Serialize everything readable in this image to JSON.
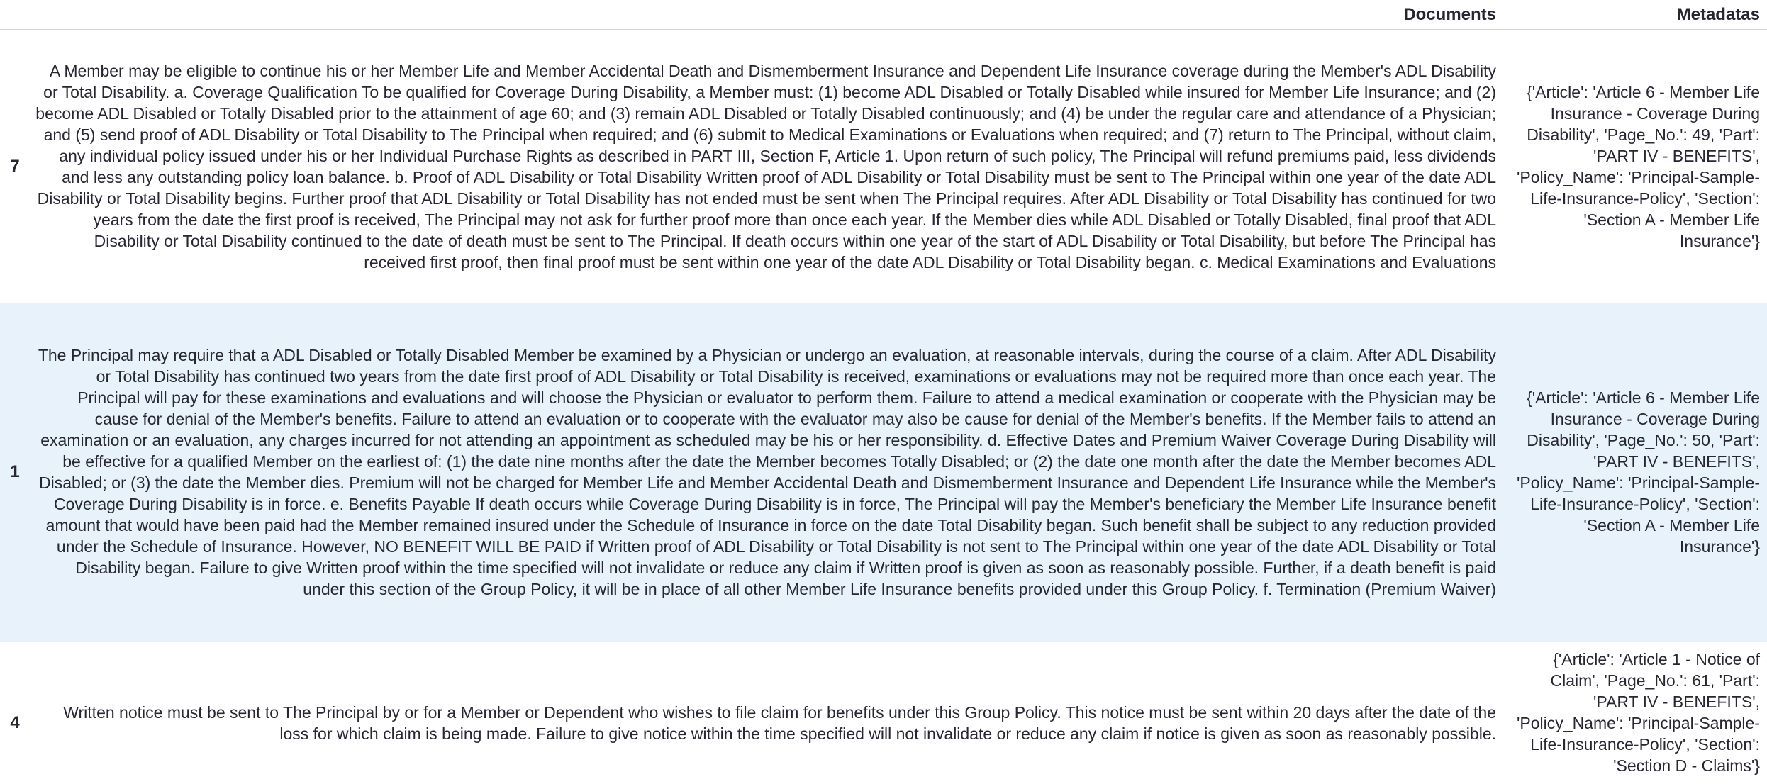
{
  "table": {
    "headers": {
      "index": "",
      "documents": "Documents",
      "metadatas": "Metadatas"
    },
    "rows": [
      {
        "index": "7",
        "document": "A Member may be eligible to continue his or her Member Life and Member Accidental Death and Dismemberment Insurance and Dependent Life Insurance coverage during the Member's ADL Disability or Total Disability. a. Coverage Qualification To be qualified for Coverage During Disability, a Member must: (1) become ADL Disabled or Totally Disabled while insured for Member Life Insurance; and (2) become ADL Disabled or Totally Disabled prior to the attainment of age 60; and (3) remain ADL Disabled or Totally Disabled continuously; and (4) be under the regular care and attendance of a Physician; and (5) send proof of ADL Disability or Total Disability to The Principal when required; and (6) submit to Medical Examinations or Evaluations when required; and (7) return to The Principal, without claim, any individual policy issued under his or her Individual Purchase Rights as described in PART III, Section F, Article 1. Upon return of such policy, The Principal will refund premiums paid, less dividends and less any outstanding policy loan balance. b. Proof of ADL Disability or Total Disability Written proof of ADL Disability or Total Disability must be sent to The Principal within one year of the date ADL Disability or Total Disability begins. Further proof that ADL Disability or Total Disability has not ended must be sent when The Principal requires. After ADL Disability or Total Disability has continued for two years from the date the first proof is received, The Principal may not ask for further proof more than once each year. If the Member dies while ADL Disabled or Totally Disabled, final proof that ADL Disability or Total Disability continued to the date of death must be sent to The Principal. If death occurs within one year of the start of ADL Disability or Total Disability, but before The Principal has received first proof, then final proof must be sent within one year of the date ADL Disability or Total Disability began. c. Medical Examinations and Evaluations",
        "metadata": "{'Article': 'Article 6 - Member Life Insurance - Coverage During Disability', 'Page_No.': 49, 'Part': 'PART IV - BENEFITS', 'Policy_Name': 'Principal-Sample-Life-Insurance-Policy', 'Section': 'Section A - Member Life Insurance'}"
      },
      {
        "index": "1",
        "document": "The Principal may require that a ADL Disabled or Totally Disabled Member be examined by a Physician or undergo an evaluation, at reasonable intervals, during the course of a claim. After ADL Disability or Total Disability has continued two years from the date first proof of ADL Disability or Total Disability is received, examinations or evaluations may not be required more than once each year. The Principal will pay for these examinations and evaluations and will choose the Physician or evaluator to perform them. Failure to attend a medical examination or cooperate with the Physician may be cause for denial of the Member's benefits. Failure to attend an evaluation or to cooperate with the evaluator may also be cause for denial of the Member's benefits. If the Member fails to attend an examination or an evaluation, any charges incurred for not attending an appointment as scheduled may be his or her responsibility. d. Effective Dates and Premium Waiver Coverage During Disability will be effective for a qualified Member on the earliest of: (1) the date nine months after the date the Member becomes Totally Disabled; or (2) the date one month after the date the Member becomes ADL Disabled; or (3) the date the Member dies. Premium will not be charged for Member Life and Member Accidental Death and Dismemberment Insurance and Dependent Life Insurance while the Member's Coverage During Disability is in force. e. Benefits Payable If death occurs while Coverage During Disability is in force, The Principal will pay the Member's beneficiary the Member Life Insurance benefit amount that would have been paid had the Member remained insured under the Schedule of Insurance in force on the date Total Disability began. Such benefit shall be subject to any reduction provided under the Schedule of Insurance. However, NO BENEFIT WILL BE PAID if Written proof of ADL Disability or Total Disability is not sent to The Principal within one year of the date ADL Disability or Total Disability began. Failure to give Written proof within the time specified will not invalidate or reduce any claim if Written proof is given as soon as reasonably possible. Further, if a death benefit is paid under this section of the Group Policy, it will be in place of all other Member Life Insurance benefits provided under this Group Policy. f. Termination (Premium Waiver)",
        "metadata": "{'Article': 'Article 6 - Member Life Insurance - Coverage During Disability', 'Page_No.': 50, 'Part': 'PART IV - BENEFITS', 'Policy_Name': 'Principal-Sample-Life-Insurance-Policy', 'Section': 'Section A - Member Life Insurance'}"
      },
      {
        "index": "4",
        "document": "Written notice must be sent to The Principal by or for a Member or Dependent who wishes to file claim for benefits under this Group Policy. This notice must be sent within 20 days after the date of the loss for which claim is being made. Failure to give notice within the time specified will not invalidate or reduce any claim if notice is given as soon as reasonably possible.",
        "metadata": "{'Article': 'Article 1 - Notice of Claim', 'Page_No.': 61, 'Part': 'PART IV - BENEFITS', 'Policy_Name': 'Principal-Sample-Life-Insurance-Policy', 'Section': 'Section D - Claims'}"
      }
    ]
  }
}
